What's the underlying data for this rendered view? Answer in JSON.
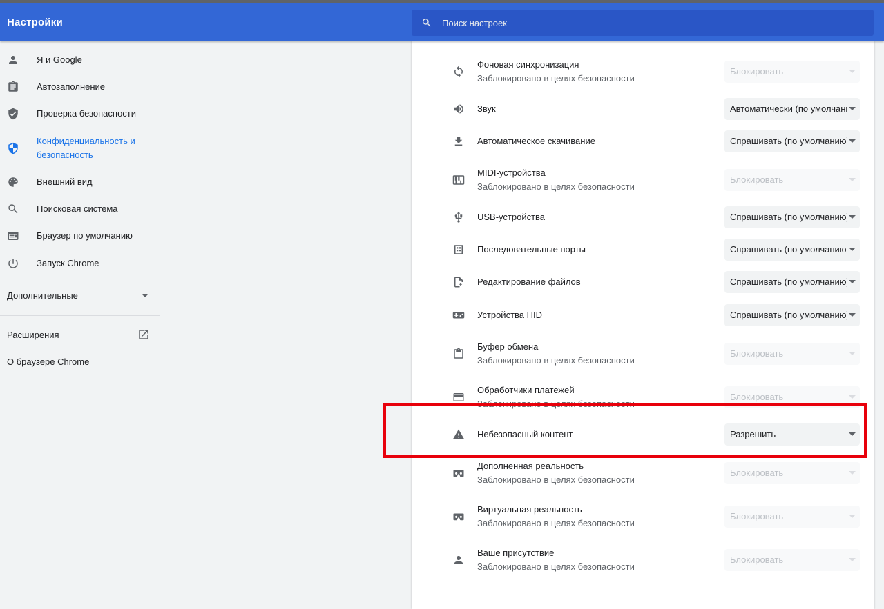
{
  "app": {
    "title": "Настройки"
  },
  "search": {
    "placeholder": "Поиск настроек",
    "icon": "search-icon"
  },
  "sidebar": {
    "items": [
      {
        "label": "Я и Google",
        "icon": "person-icon",
        "active": false
      },
      {
        "label": "Автозаполнение",
        "icon": "clipboard-list-icon",
        "active": false
      },
      {
        "label": "Проверка безопасности",
        "icon": "shield-check-icon",
        "active": false
      },
      {
        "label": "Конфиденциальность и безопасность",
        "icon": "shield-icon",
        "active": true
      },
      {
        "label": "Внешний вид",
        "icon": "palette-icon",
        "active": false
      },
      {
        "label": "Поисковая система",
        "icon": "search-icon",
        "active": false
      },
      {
        "label": "Браузер по умолчанию",
        "icon": "browser-icon",
        "active": false
      },
      {
        "label": "Запуск Chrome",
        "icon": "power-icon",
        "active": false
      }
    ],
    "advanced": {
      "label": "Дополнительные",
      "icon": "chevron-down-icon"
    },
    "extensions": {
      "label": "Расширения",
      "icon": "open-in-new-icon"
    },
    "about": {
      "label": "О браузере Chrome"
    }
  },
  "content": {
    "rows": [
      {
        "title": "Фоновая синхронизация",
        "subtitle": "Заблокировано в целях безопасности",
        "value": "Блокировать",
        "disabled": true,
        "icon": "sync-icon"
      },
      {
        "title": "Звук",
        "subtitle": "",
        "value": "Автоматически (по умолчанию)",
        "disabled": false,
        "icon": "volume-icon"
      },
      {
        "title": "Автоматическое скачивание",
        "subtitle": "",
        "value": "Спрашивать (по умолчанию)",
        "disabled": false,
        "icon": "download-icon"
      },
      {
        "title": "MIDI-устройства",
        "subtitle": "Заблокировано в целях безопасности",
        "value": "Блокировать",
        "disabled": true,
        "icon": "piano-icon"
      },
      {
        "title": "USB-устройства",
        "subtitle": "",
        "value": "Спрашивать (по умолчанию)",
        "disabled": false,
        "icon": "usb-icon"
      },
      {
        "title": "Последовательные порты",
        "subtitle": "",
        "value": "Спрашивать (по умолчанию)",
        "disabled": false,
        "icon": "serial-port-icon"
      },
      {
        "title": "Редактирование файлов",
        "subtitle": "",
        "value": "Спрашивать (по умолчанию)",
        "disabled": false,
        "icon": "file-edit-icon"
      },
      {
        "title": "Устройства HID",
        "subtitle": "",
        "value": "Спрашивать (по умолчанию)",
        "disabled": false,
        "icon": "gamepad-icon"
      },
      {
        "title": "Буфер обмена",
        "subtitle": "Заблокировано в целях безопасности",
        "value": "Блокировать",
        "disabled": true,
        "icon": "clipboard-icon"
      },
      {
        "title": "Обработчики платежей",
        "subtitle": "Заблокировано в целях безопасности",
        "value": "Блокировать",
        "disabled": true,
        "icon": "credit-card-icon"
      },
      {
        "title": "Небезопасный контент",
        "subtitle": "",
        "value": "Разрешить",
        "disabled": false,
        "icon": "warning-icon"
      },
      {
        "title": "Дополненная реальность",
        "subtitle": "Заблокировано в целях безопасности",
        "value": "Блокировать",
        "disabled": true,
        "icon": "vr-headset-icon"
      },
      {
        "title": "Виртуальная реальность",
        "subtitle": "Заблокировано в целях безопасности",
        "value": "Блокировать",
        "disabled": true,
        "icon": "vr-headset-icon"
      },
      {
        "title": "Ваше присутствие",
        "subtitle": "Заблокировано в целях безопасности",
        "value": "Блокировать",
        "disabled": true,
        "icon": "person-icon"
      }
    ]
  },
  "colors": {
    "header": "#3367d6",
    "accent": "#1a73e8",
    "highlight": "#e8000b"
  }
}
